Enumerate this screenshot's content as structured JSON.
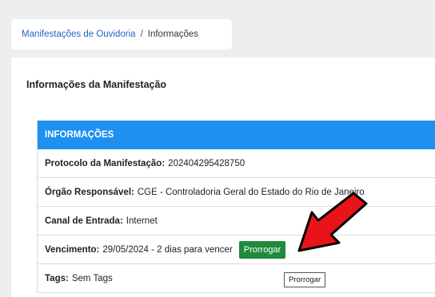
{
  "breadcrumb": {
    "link": "Manifestações de Ouvidoria",
    "separator": "/",
    "current": "Informações"
  },
  "panel": {
    "title": "Informações da Manifestação"
  },
  "info": {
    "header": "INFORMAÇÕES",
    "rows": [
      {
        "label": "Protocolo da Manifestação:",
        "value": "202404295428750"
      },
      {
        "label": "Órgão Responsável:",
        "value": "CGE - Controladoria Geral do Estado do Rio de Janeiro"
      },
      {
        "label": "Canal de Entrada:",
        "value": "Internet"
      },
      {
        "label": "Vencimento:",
        "value": "29/05/2024 - 2 dias para vencer"
      },
      {
        "label": "Tags:",
        "value": "Sem Tags"
      }
    ],
    "action_button": "Prorrogar",
    "tooltip": "Prorrogar"
  },
  "colors": {
    "header_bg": "#1e90f0",
    "button_bg": "#1e8a3a",
    "arrow": "#e8141a",
    "link": "#1f66c4"
  },
  "icons": {
    "annotation": "red-arrow-icon"
  }
}
